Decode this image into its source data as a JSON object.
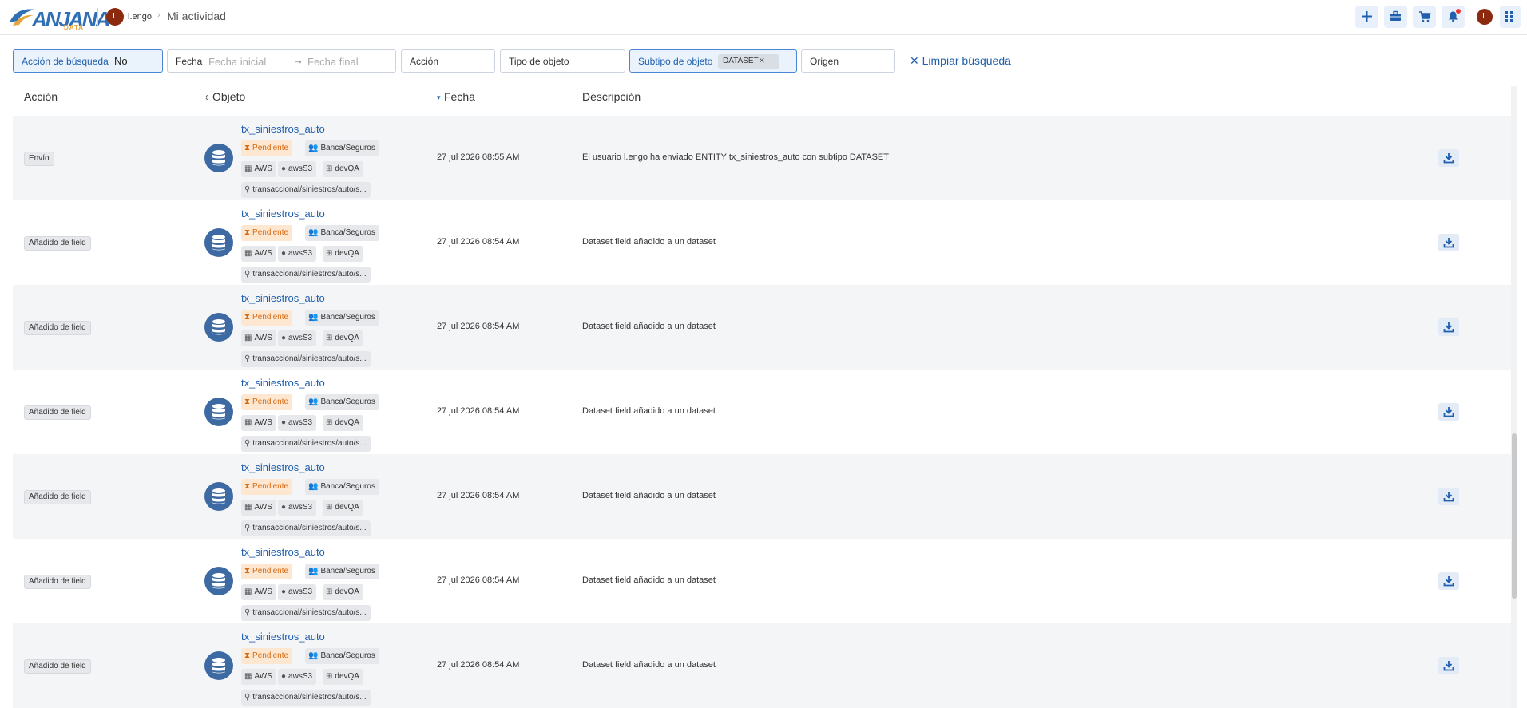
{
  "header": {
    "logo_text": "ANJANA",
    "logo_sub": "DATA",
    "avatar_initial": "L",
    "user": "l.engo",
    "breadcrumb_sep": "›",
    "page_title": "Mi actividad",
    "icons": [
      "plus-icon",
      "briefcase-icon",
      "cart-icon",
      "bell-icon",
      "avatar",
      "apps-grid-icon"
    ]
  },
  "filters": {
    "busqueda": {
      "label": "Acción de búsqueda",
      "value": "No"
    },
    "fecha": {
      "label": "Fecha",
      "start_placeholder": "Fecha inicial",
      "arrow": "→",
      "end_placeholder": "Fecha final"
    },
    "accion": {
      "label": "Acción"
    },
    "tipo": {
      "label": "Tipo de objeto"
    },
    "subtipo": {
      "label": "Subtipo de objeto",
      "chip": "DATASET",
      "remove": "×"
    },
    "origen": {
      "label": "Origen"
    },
    "clear": "✕ Limpiar búsqueda"
  },
  "table": {
    "columns": {
      "accion": "Acción",
      "objeto": "Objeto",
      "fecha": "Fecha",
      "descripcion": "Descripción"
    },
    "sort_objeto": "⇕",
    "sort_fecha": "▾",
    "rows": [
      {
        "action": "Envío",
        "name": "tx_siniestros_auto",
        "status": "Pendiente",
        "group": "Banca/Seguros",
        "platform": "AWS",
        "source": "awsS3",
        "env": "devQA",
        "path": "transaccional/siniestros/auto/s...",
        "date": "27 jul 2026 08:55 AM",
        "description": "El usuario l.engo ha enviado ENTITY tx_siniestros_auto con subtipo DATASET"
      },
      {
        "action": "Añadido de field",
        "name": "tx_siniestros_auto",
        "status": "Pendiente",
        "group": "Banca/Seguros",
        "platform": "AWS",
        "source": "awsS3",
        "env": "devQA",
        "path": "transaccional/siniestros/auto/s...",
        "date": "27 jul 2026 08:54 AM",
        "description": "Dataset field añadido a un dataset"
      },
      {
        "action": "Añadido de field",
        "name": "tx_siniestros_auto",
        "status": "Pendiente",
        "group": "Banca/Seguros",
        "platform": "AWS",
        "source": "awsS3",
        "env": "devQA",
        "path": "transaccional/siniestros/auto/s...",
        "date": "27 jul 2026 08:54 AM",
        "description": "Dataset field añadido a un dataset"
      },
      {
        "action": "Añadido de field",
        "name": "tx_siniestros_auto",
        "status": "Pendiente",
        "group": "Banca/Seguros",
        "platform": "AWS",
        "source": "awsS3",
        "env": "devQA",
        "path": "transaccional/siniestros/auto/s...",
        "date": "27 jul 2026 08:54 AM",
        "description": "Dataset field añadido a un dataset"
      },
      {
        "action": "Añadido de field",
        "name": "tx_siniestros_auto",
        "status": "Pendiente",
        "group": "Banca/Seguros",
        "platform": "AWS",
        "source": "awsS3",
        "env": "devQA",
        "path": "transaccional/siniestros/auto/s...",
        "date": "27 jul 2026 08:54 AM",
        "description": "Dataset field añadido a un dataset"
      },
      {
        "action": "Añadido de field",
        "name": "tx_siniestros_auto",
        "status": "Pendiente",
        "group": "Banca/Seguros",
        "platform": "AWS",
        "source": "awsS3",
        "env": "devQA",
        "path": "transaccional/siniestros/auto/s...",
        "date": "27 jul 2026 08:54 AM",
        "description": "Dataset field añadido a un dataset"
      },
      {
        "action": "Añadido de field",
        "name": "tx_siniestros_auto",
        "status": "Pendiente",
        "group": "Banca/Seguros",
        "platform": "AWS",
        "source": "awsS3",
        "env": "devQA",
        "path": "transaccional/siniestros/auto/s...",
        "date": "27 jul 2026 08:54 AM",
        "description": "Dataset field añadido a un dataset"
      }
    ]
  },
  "colors": {
    "accent": "#1f5fad",
    "pending_bg": "#fde7d1",
    "pending_text": "#d86a12",
    "avatar": "#8b2a0e",
    "db_icon": "#3e6aa3"
  }
}
